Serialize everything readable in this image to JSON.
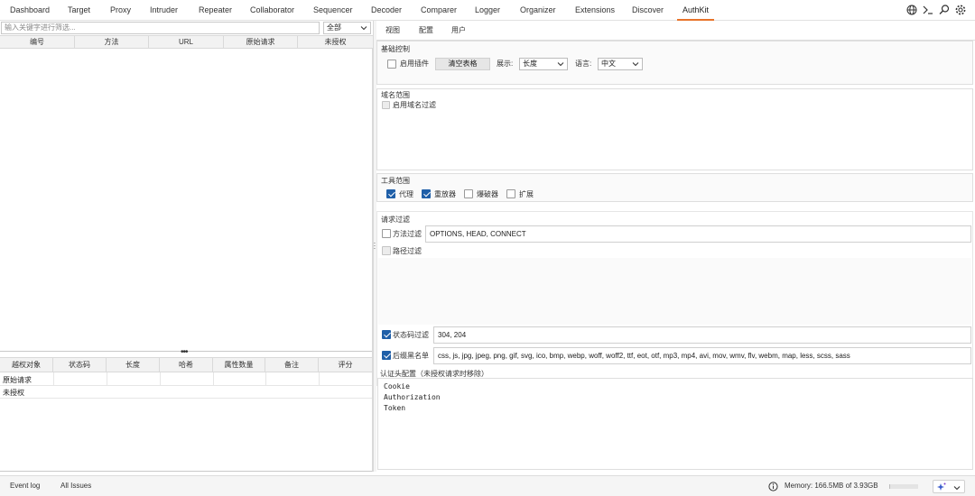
{
  "top_tabs": [
    "Dashboard",
    "Target",
    "Proxy",
    "Intruder",
    "Repeater",
    "Collaborator",
    "Sequencer",
    "Decoder",
    "Comparer",
    "Logger",
    "Organizer",
    "Extensions",
    "Discover",
    "AuthKit"
  ],
  "active_tab": "AuthKit",
  "accent_color": "#e8732a",
  "checkbox_color": "#1f5fa8",
  "top_icons": [
    "globe-icon",
    "terminal-icon",
    "search-icon",
    "settings-icon"
  ],
  "left": {
    "filter_placeholder": "输入关键字进行筛选...",
    "filter_scope": "全部",
    "columns": [
      "编号",
      "方法",
      "URL",
      "原始请求",
      "未授权"
    ],
    "bottom_columns": [
      "越权对象",
      "状态码",
      "长度",
      "哈希",
      "属性数量",
      "备注",
      "评分"
    ],
    "bottom_rows": [
      "原始请求",
      "未授权"
    ]
  },
  "right": {
    "subtabs": [
      "视图",
      "配置",
      "用户"
    ],
    "active_subtab": "配置",
    "basic": {
      "title": "基础控制",
      "enable_plugin": "启用插件",
      "enable_plugin_checked": false,
      "clear_button": "清空表格",
      "display_label": "展示:",
      "display_value": "长度",
      "language_label": "语言:",
      "language_value": "中文"
    },
    "domain": {
      "title": "域名范围",
      "enable_filter": "启用域名过滤",
      "enable_filter_checked": false
    },
    "tools": {
      "title": "工具范围",
      "items": [
        {
          "label": "代理",
          "checked": true
        },
        {
          "label": "重放器",
          "checked": true
        },
        {
          "label": "爆破器",
          "checked": false
        },
        {
          "label": "扩展",
          "checked": false
        }
      ]
    },
    "request_filter": {
      "title": "请求过滤",
      "method_label": "方法过滤",
      "method_checked": false,
      "method_value": "OPTIONS, HEAD, CONNECT",
      "path_label": "路径过滤",
      "path_checked": false,
      "status_label": "状态码过滤",
      "status_checked": true,
      "status_value": "304, 204",
      "suffix_label": "后缀黑名单",
      "suffix_checked": true,
      "suffix_value": "css, js, jpg, jpeg, png, gif, svg, ico, bmp, webp, woff, woff2, ttf, eot, otf, mp3, mp4, avi, mov, wmv, flv, webm, map, less, scss, sass"
    },
    "auth_header": {
      "title": "认证头配置（未授权请求时移除）",
      "lines": [
        "Cookie",
        "Authorization",
        "Token"
      ]
    }
  },
  "status_bar": {
    "event_log": "Event log",
    "all_issues": "All Issues",
    "memory": "Memory: 166.5MB of 3.93GB",
    "memory_fraction": 0.042
  }
}
